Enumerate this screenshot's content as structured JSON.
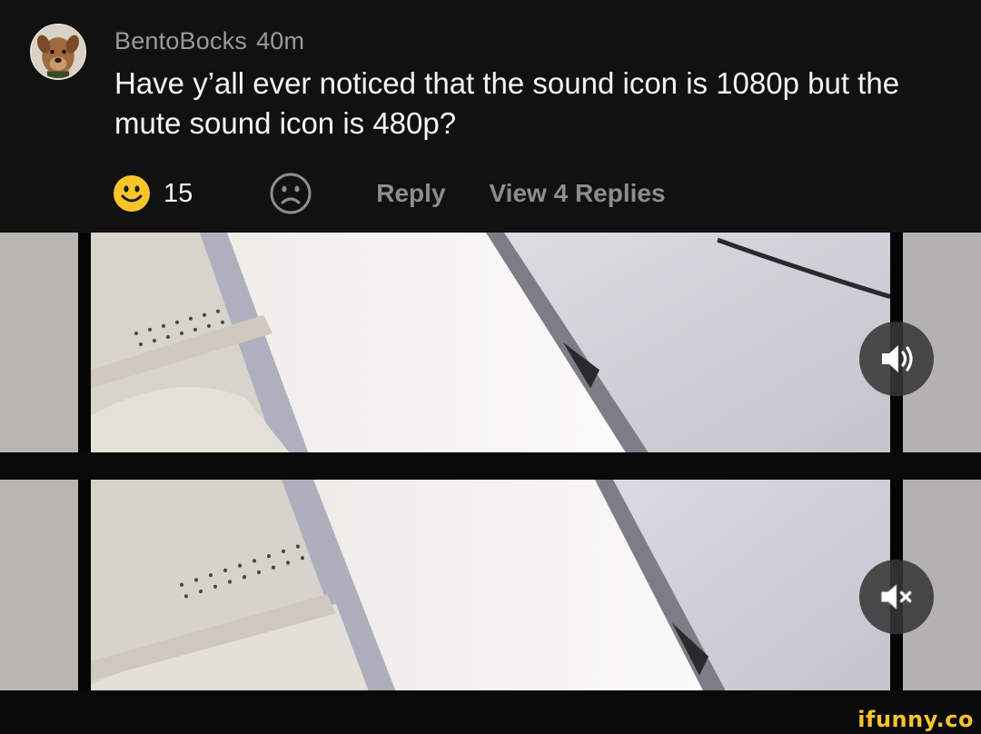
{
  "comment": {
    "username": "BentoBocks",
    "time": "40m",
    "text": "Have y’all ever noticed that the sound icon is 1080p but the mute sound icon is 480p?",
    "smile_count": "15",
    "reply_label": "Reply",
    "view_replies_label": "View 4 Replies"
  },
  "icons": {
    "avatar": "dog-avatar",
    "smile": "smiley-face-icon",
    "frown": "frown-face-icon",
    "sound": "speaker-volume-icon",
    "mute": "speaker-mute-icon"
  },
  "colors": {
    "background": "#111111",
    "smile_yellow": "#f7c52a",
    "muted_text": "#8d8d8d",
    "watermark": "#f7c52a"
  },
  "watermark": "ifunny.co"
}
